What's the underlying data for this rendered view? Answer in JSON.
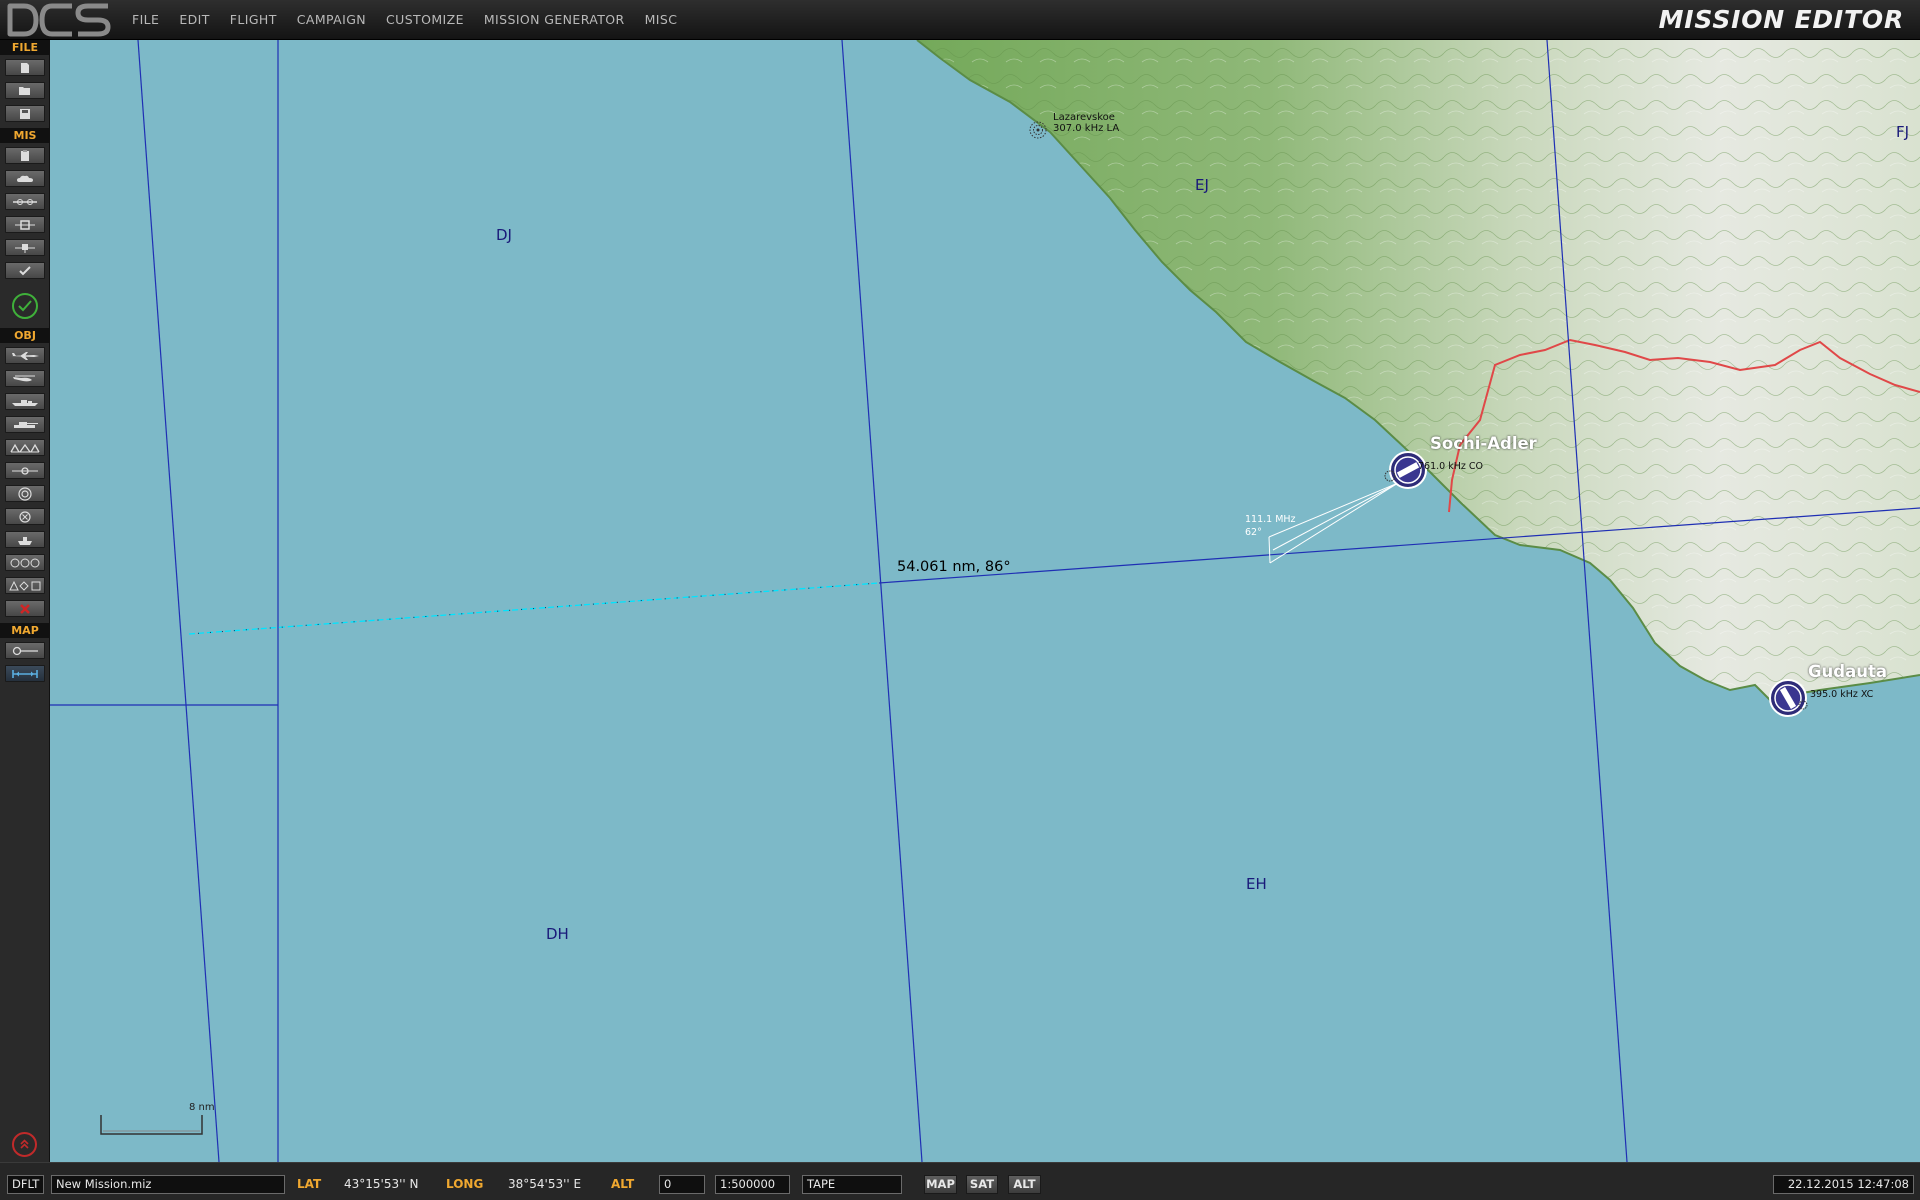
{
  "app": {
    "title": "MISSION EDITOR",
    "logo_text": "DCS"
  },
  "menu": {
    "items": [
      "FILE",
      "EDIT",
      "FLIGHT",
      "CAMPAIGN",
      "CUSTOMIZE",
      "MISSION GENERATOR",
      "MISC"
    ]
  },
  "toolbar": {
    "file_header": "FILE",
    "mis_header": "MIS",
    "obj_header": "OBJ",
    "map_header": "MAP",
    "file_buttons": [
      "new-file-icon",
      "open-folder-icon",
      "save-icon"
    ],
    "mis_buttons": [
      "briefing-icon",
      "weather-icon",
      "trigger-icon",
      "triggered-zone-icon",
      "goals-icon",
      "check-icon"
    ],
    "obj_buttons": [
      "airplane-icon",
      "helicopter-icon",
      "ship-icon",
      "ground-vehicle-icon",
      "static-object-icon",
      "template-icon",
      "trigger-zone-icon",
      "nav-point-icon",
      "ship-static-icon",
      "formation-icon",
      "shapes-icon",
      "delete-icon"
    ],
    "map_buttons": [
      "map-options-icon",
      "tape-measure-icon"
    ]
  },
  "map": {
    "grid_labels": [
      {
        "id": "dj",
        "text": "DJ"
      },
      {
        "id": "ej",
        "text": "EJ"
      },
      {
        "id": "fj",
        "text": "FJ"
      },
      {
        "id": "dh",
        "text": "DH"
      },
      {
        "id": "eh",
        "text": "EH"
      }
    ],
    "ndb": {
      "name": "Lazarevskoe",
      "freq": "307.0 kHz LA"
    },
    "airfields": [
      {
        "id": "sochi",
        "name": "Sochi-Adler",
        "freq": "761.0 kHz CO"
      },
      {
        "id": "gudauta",
        "name": "Gudauta",
        "freq": "395.0 kHz XC"
      }
    ],
    "ils": {
      "freq": "111.1 MHz",
      "course": "62°"
    },
    "tape": "54.061 nm, 86°",
    "scale": "8 nm",
    "colors": {
      "sea": "#7db9c8",
      "land": "#74a95a",
      "grid": "#1f2fb4",
      "border": "#e04848",
      "tape_line": "#00ffff"
    }
  },
  "status": {
    "profile": "DFLT",
    "mission_file": "New Mission.miz",
    "lat_label": "LAT",
    "lat_value": "43°15'53'' N",
    "long_label": "LONG",
    "long_value": "38°54'53'' E",
    "alt_label": "ALT",
    "alt_value": "0",
    "scale_value": "1:500000",
    "mode_value": "TAPE",
    "btn_map": "MAP",
    "btn_sat": "SAT",
    "btn_alt": "ALT",
    "datetime": "22.12.2015 12:47:08"
  }
}
